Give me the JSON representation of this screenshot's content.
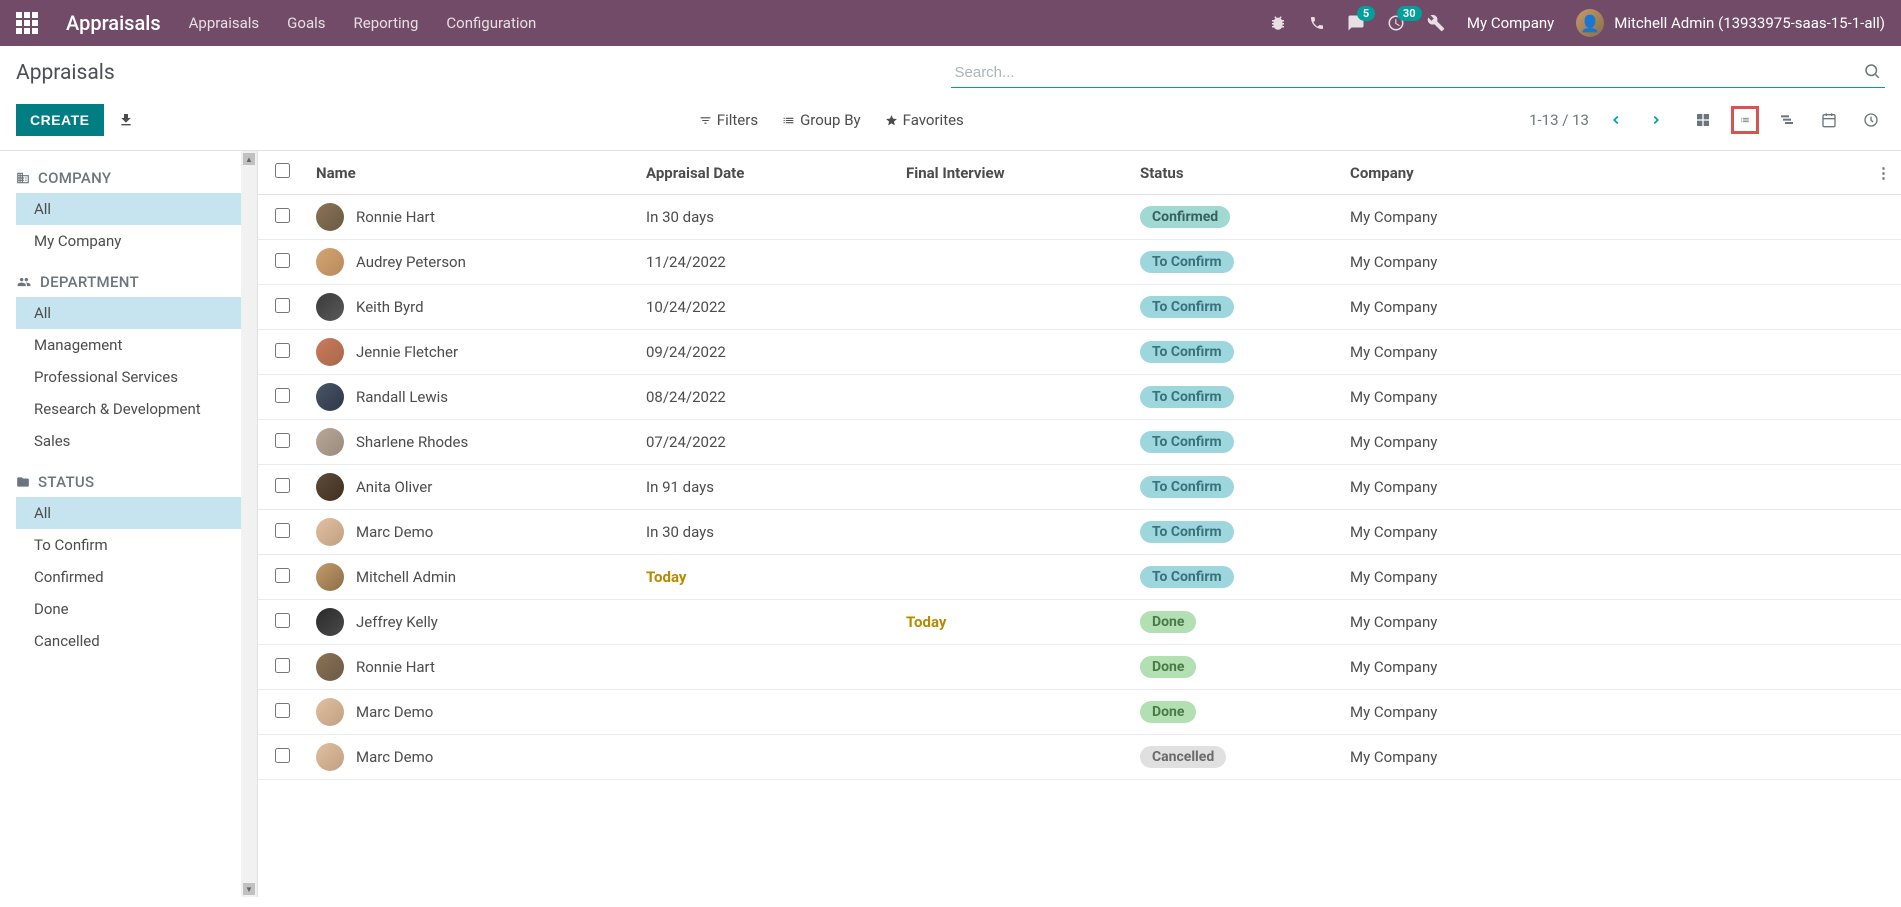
{
  "navbar": {
    "brand": "Appraisals",
    "menu": [
      "Appraisals",
      "Goals",
      "Reporting",
      "Configuration"
    ],
    "messages_badge": "5",
    "activities_badge": "30",
    "company": "My Company",
    "user": "Mitchell Admin (13933975-saas-15-1-all)"
  },
  "control": {
    "title": "Appraisals",
    "search_placeholder": "Search...",
    "create": "CREATE",
    "filters": "Filters",
    "groupby": "Group By",
    "favorites": "Favorites",
    "pager": "1-13 / 13"
  },
  "sidebar": {
    "sections": [
      {
        "title": "COMPANY",
        "icon": "building",
        "items": [
          {
            "label": "All",
            "selected": true
          },
          {
            "label": "My Company",
            "selected": false
          }
        ]
      },
      {
        "title": "DEPARTMENT",
        "icon": "users",
        "items": [
          {
            "label": "All",
            "selected": true
          },
          {
            "label": "Management",
            "selected": false
          },
          {
            "label": "Professional Services",
            "selected": false
          },
          {
            "label": "Research & Development",
            "selected": false
          },
          {
            "label": "Sales",
            "selected": false
          }
        ]
      },
      {
        "title": "STATUS",
        "icon": "folder",
        "items": [
          {
            "label": "All",
            "selected": true
          },
          {
            "label": "To Confirm",
            "selected": false
          },
          {
            "label": "Confirmed",
            "selected": false
          },
          {
            "label": "Done",
            "selected": false
          },
          {
            "label": "Cancelled",
            "selected": false
          }
        ]
      }
    ]
  },
  "table": {
    "columns": [
      "Name",
      "Appraisal Date",
      "Final Interview",
      "Status",
      "Company"
    ],
    "rows": [
      {
        "name": "Ronnie Hart",
        "av": "av1",
        "date": "In 30 days",
        "date_hl": false,
        "interview": "",
        "int_hl": false,
        "status": "Confirmed",
        "status_cls": "status-confirmed",
        "company": "My Company"
      },
      {
        "name": "Audrey Peterson",
        "av": "av2",
        "date": "11/24/2022",
        "date_hl": false,
        "interview": "",
        "int_hl": false,
        "status": "To Confirm",
        "status_cls": "status-toconfirm",
        "company": "My Company"
      },
      {
        "name": "Keith Byrd",
        "av": "av3",
        "date": "10/24/2022",
        "date_hl": false,
        "interview": "",
        "int_hl": false,
        "status": "To Confirm",
        "status_cls": "status-toconfirm",
        "company": "My Company"
      },
      {
        "name": "Jennie Fletcher",
        "av": "av4",
        "date": "09/24/2022",
        "date_hl": false,
        "interview": "",
        "int_hl": false,
        "status": "To Confirm",
        "status_cls": "status-toconfirm",
        "company": "My Company"
      },
      {
        "name": "Randall Lewis",
        "av": "av5",
        "date": "08/24/2022",
        "date_hl": false,
        "interview": "",
        "int_hl": false,
        "status": "To Confirm",
        "status_cls": "status-toconfirm",
        "company": "My Company"
      },
      {
        "name": "Sharlene Rhodes",
        "av": "av6",
        "date": "07/24/2022",
        "date_hl": false,
        "interview": "",
        "int_hl": false,
        "status": "To Confirm",
        "status_cls": "status-toconfirm",
        "company": "My Company"
      },
      {
        "name": "Anita Oliver",
        "av": "av7",
        "date": "In 91 days",
        "date_hl": false,
        "interview": "",
        "int_hl": false,
        "status": "To Confirm",
        "status_cls": "status-toconfirm",
        "company": "My Company"
      },
      {
        "name": "Marc Demo",
        "av": "av8",
        "date": "In 30 days",
        "date_hl": false,
        "interview": "",
        "int_hl": false,
        "status": "To Confirm",
        "status_cls": "status-toconfirm",
        "company": "My Company"
      },
      {
        "name": "Mitchell Admin",
        "av": "av9",
        "date": "Today",
        "date_hl": true,
        "interview": "",
        "int_hl": false,
        "status": "To Confirm",
        "status_cls": "status-toconfirm",
        "company": "My Company"
      },
      {
        "name": "Jeffrey Kelly",
        "av": "av10",
        "date": "",
        "date_hl": false,
        "interview": "Today",
        "int_hl": true,
        "status": "Done",
        "status_cls": "status-done",
        "company": "My Company"
      },
      {
        "name": "Ronnie Hart",
        "av": "av1",
        "date": "",
        "date_hl": false,
        "interview": "",
        "int_hl": false,
        "status": "Done",
        "status_cls": "status-done",
        "company": "My Company"
      },
      {
        "name": "Marc Demo",
        "av": "av8",
        "date": "",
        "date_hl": false,
        "interview": "",
        "int_hl": false,
        "status": "Done",
        "status_cls": "status-done",
        "company": "My Company"
      },
      {
        "name": "Marc Demo",
        "av": "av8",
        "date": "",
        "date_hl": false,
        "interview": "",
        "int_hl": false,
        "status": "Cancelled",
        "status_cls": "status-cancelled",
        "company": "My Company"
      }
    ]
  }
}
